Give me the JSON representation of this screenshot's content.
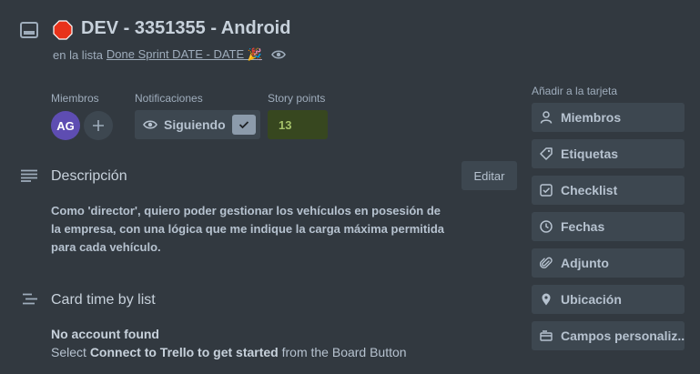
{
  "card": {
    "title": "DEV - 3351355 - Android",
    "list_prefix": "en la lista",
    "list_name": "Done Sprint DATE - DATE 🎉"
  },
  "fields": {
    "members_label": "Miembros",
    "member_initials": "AG",
    "notifications_label": "Notificaciones",
    "watching_label": "Siguiendo",
    "story_points_label": "Story points",
    "story_points_value": "13"
  },
  "description": {
    "title": "Descripción",
    "edit_label": "Editar",
    "text": "Como 'director', quiero poder gestionar los vehículos en posesión de la empresa, con una lógica que me indique la carga máxima permitida para cada vehículo."
  },
  "card_time": {
    "title": "Card time by list",
    "no_account": "No account found",
    "select_prefix": "Select",
    "connect_bold": "Connect to Trello to get started",
    "select_suffix": "from the Board Button"
  },
  "sidebar": {
    "title": "Añadir a la tarjeta",
    "buttons": [
      {
        "label": "Miembros",
        "icon": "person-icon"
      },
      {
        "label": "Etiquetas",
        "icon": "tag-icon"
      },
      {
        "label": "Checklist",
        "icon": "checklist-icon"
      },
      {
        "label": "Fechas",
        "icon": "clock-icon"
      },
      {
        "label": "Adjunto",
        "icon": "paperclip-icon"
      },
      {
        "label": "Ubicación",
        "icon": "location-pin-icon"
      },
      {
        "label": "Campos personaliz...",
        "icon": "custom-fields-icon"
      }
    ]
  },
  "colors": {
    "background": "#323940",
    "button": "#3d4750",
    "avatar": "#5e4db2",
    "story_points_bg": "#37471f",
    "story_points_text": "#a5c26a",
    "stop_red": "#e8321a"
  }
}
